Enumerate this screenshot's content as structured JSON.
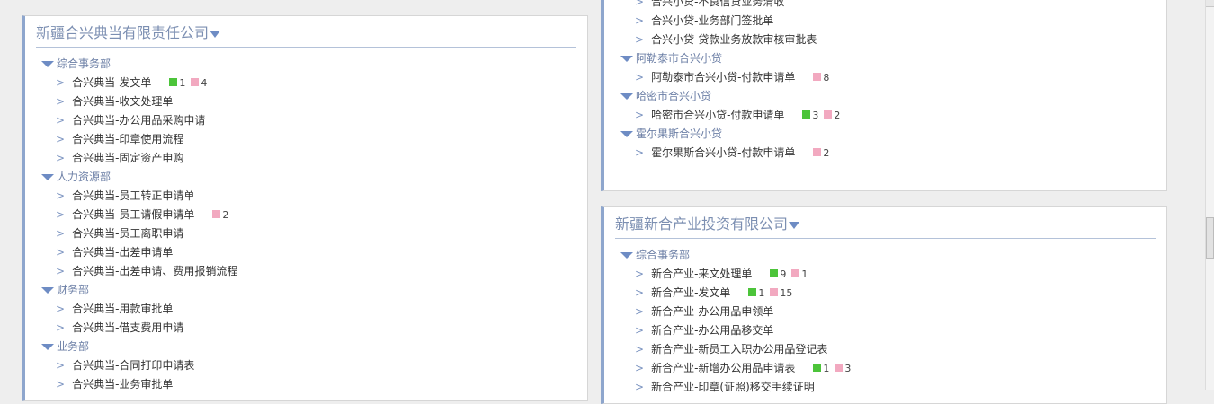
{
  "panels": [
    {
      "id": "left",
      "title": "新疆合兴典当有限责任公司",
      "groups": [
        {
          "dept": "综合事务部",
          "items": [
            {
              "label": "合兴典当-发文单",
              "green": "1",
              "pink": "4"
            },
            {
              "label": "合兴典当-收文处理单"
            },
            {
              "label": "合兴典当-办公用品采购申请"
            },
            {
              "label": "合兴典当-印章使用流程"
            },
            {
              "label": "合兴典当-固定资产申购"
            }
          ]
        },
        {
          "dept": "人力资源部",
          "items": [
            {
              "label": "合兴典当-员工转正申请单"
            },
            {
              "label": "合兴典当-员工请假申请单",
              "pink": "2"
            },
            {
              "label": "合兴典当-员工离职申请"
            },
            {
              "label": "合兴典当-出差申请单"
            },
            {
              "label": "合兴典当-出差申请、费用报销流程"
            }
          ]
        },
        {
          "dept": "财务部",
          "items": [
            {
              "label": "合兴典当-用款审批单"
            },
            {
              "label": "合兴典当-借支费用申请"
            }
          ]
        },
        {
          "dept": "业务部",
          "items": [
            {
              "label": "合兴典当-合同打印申请表"
            },
            {
              "label": "合兴典当-业务审批单"
            }
          ]
        }
      ]
    },
    {
      "id": "rtop",
      "title": "",
      "groups": [
        {
          "dept": "",
          "items": [
            {
              "label": "合兴小贷-不良信贷业务清收"
            },
            {
              "label": "合兴小贷-业务部门签批单"
            },
            {
              "label": "合兴小贷-贷款业务放款审核审批表"
            }
          ]
        },
        {
          "dept": "阿勒泰市合兴小贷",
          "items": [
            {
              "label": "阿勒泰市合兴小贷-付款申请单",
              "pink": "8"
            }
          ]
        },
        {
          "dept": "哈密市合兴小贷",
          "items": [
            {
              "label": "哈密市合兴小贷-付款申请单",
              "green": "3",
              "pink": "2"
            }
          ]
        },
        {
          "dept": "霍尔果斯合兴小贷",
          "items": [
            {
              "label": "霍尔果斯合兴小贷-付款申请单",
              "pink": "2"
            }
          ]
        }
      ]
    },
    {
      "id": "rbot",
      "title": "新疆新合产业投资有限公司",
      "groups": [
        {
          "dept": "综合事务部",
          "items": [
            {
              "label": "新合产业-来文处理单",
              "green": "9",
              "pink": "1"
            },
            {
              "label": "新合产业-发文单",
              "green": "1",
              "pink": "15"
            },
            {
              "label": "新合产业-办公用品申领单"
            },
            {
              "label": "新合产业-办公用品移交单"
            },
            {
              "label": "新合产业-新员工入职办公用品登记表"
            },
            {
              "label": "新合产业-新增办公用品申请表",
              "green": "1",
              "pink": "3"
            },
            {
              "label": "新合产业-印章(证照)移交手续证明"
            }
          ]
        }
      ]
    }
  ],
  "colors": {
    "accent": "#8ea6cd",
    "title": "#7c8fb2",
    "badge_new": "#4cc43a",
    "badge_pending": "#f2a9c0"
  },
  "icons": {
    "expand": "triangle-down-icon",
    "item": "chevron-right-icon"
  }
}
